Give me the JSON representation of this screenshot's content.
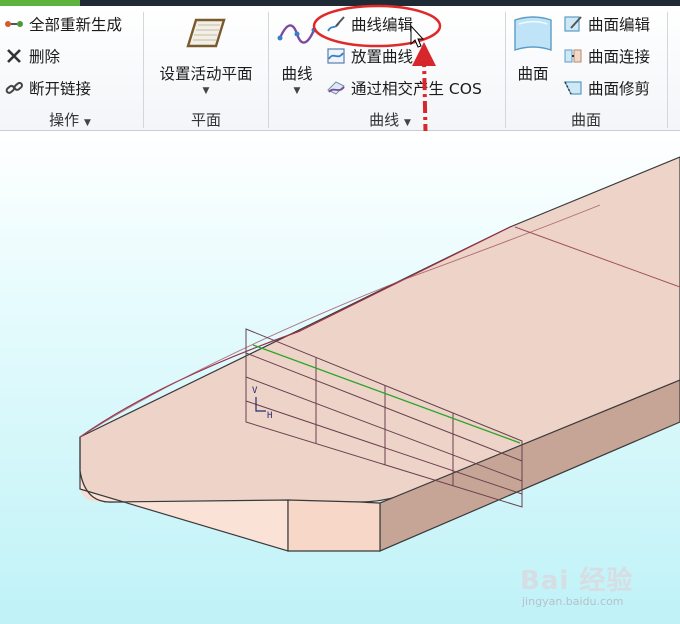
{
  "ribbon": {
    "ops": {
      "items": [
        {
          "label": "全部重新生成",
          "icon": "regenerate-icon"
        },
        {
          "label": "删除",
          "icon": "delete-icon"
        },
        {
          "label": "断开链接",
          "icon": "break-link-icon"
        }
      ],
      "group_label": "操作"
    },
    "plane": {
      "button_label": "设置活动平面",
      "group_label": "平面"
    },
    "curve": {
      "button_label": "曲线",
      "items": [
        {
          "label": "曲线编辑",
          "icon": "curve-edit-icon"
        },
        {
          "label": "放置曲线",
          "icon": "place-curve-icon"
        },
        {
          "label": "通过相交产生  COS",
          "icon": "intersect-cos-icon"
        }
      ],
      "group_label": "曲线"
    },
    "surface": {
      "button_label": "曲面",
      "items": [
        {
          "label": "曲面编辑",
          "icon": "surface-edit-icon"
        },
        {
          "label": "曲面连接",
          "icon": "surface-connect-icon"
        },
        {
          "label": "曲面修剪",
          "icon": "surface-trim-icon"
        }
      ],
      "group_label": "曲面"
    }
  },
  "viewport": {
    "axis_v": "V",
    "axis_h": "H"
  },
  "watermark": {
    "logo": "Bai 经验",
    "url": "jingyan.baidu.com"
  },
  "colors": {
    "highlight_circle": "#e02a2a",
    "arrow": "#d8262d",
    "part_top": "#edd3c8",
    "part_side": "#c6a596",
    "guide_green": "#2aa52a"
  }
}
